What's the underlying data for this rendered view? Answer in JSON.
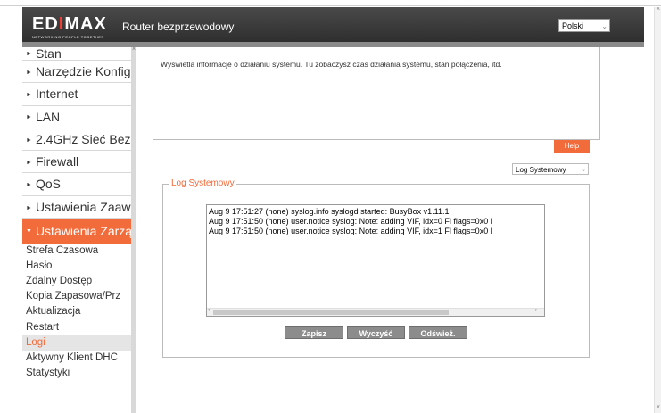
{
  "header": {
    "logo_text": "EDIMAX",
    "logo_tagline": "NETWORKING PEOPLE TOGETHER",
    "title": "Router bezprzewodowy",
    "language": "Polski"
  },
  "sidebar": {
    "items": [
      {
        "label": "Stan"
      },
      {
        "label": "Narzędzie Konfigu"
      },
      {
        "label": "Internet"
      },
      {
        "label": "LAN"
      },
      {
        "label": "2.4GHz Sieć Bezp"
      },
      {
        "label": "Firewall"
      },
      {
        "label": "QoS"
      },
      {
        "label": "Ustawienia Zaawa"
      },
      {
        "label": "Ustawienia Zarzą"
      }
    ],
    "subitems": [
      {
        "label": "Strefa Czasowa"
      },
      {
        "label": "Hasło"
      },
      {
        "label": "Zdalny Dostęp"
      },
      {
        "label": "Kopia Zapasowa/Prz"
      },
      {
        "label": "Aktualizacja"
      },
      {
        "label": "Restart"
      },
      {
        "label": "Logi"
      },
      {
        "label": "Aktywny Klient DHC"
      },
      {
        "label": "Statystyki"
      }
    ]
  },
  "main": {
    "info_text": "Wyświetla informacje o działaniu systemu. Tu zobaczysz czas działania systemu, stan połączenia, itd.",
    "help_label": "Help",
    "log_select": "Log Systemowy",
    "legend": "Log Systemowy",
    "log_lines": [
      "Aug  9 17:51:27 (none) syslog.info syslogd started: BusyBox v1.11.1",
      "Aug  9 17:51:50 (none) user.notice syslog: Note: adding VIF, idx=0 Fl flags=0x0 l",
      "Aug  9 17:51:50 (none) user.notice syslog: Note: adding VIF, idx=1 Fl flags=0x0 l"
    ],
    "buttons": {
      "save": "Zapisz",
      "clear": "Wyczyść",
      "refresh": "Odśwież."
    }
  },
  "colors": {
    "accent": "#f26b3a",
    "header_bg": "#333333",
    "button_bg": "#8c8c8c"
  },
  "icons": {
    "collapsed": "triangle-right-icon",
    "expanded": "triangle-down-icon",
    "dropdown": "chevron-down-icon"
  }
}
